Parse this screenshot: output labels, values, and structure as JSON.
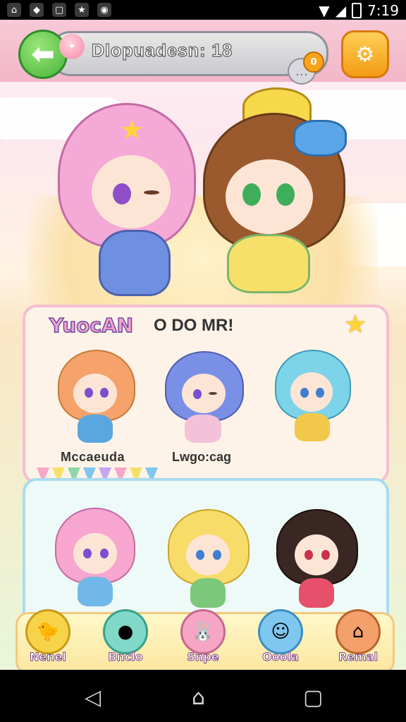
{
  "status_bar": {
    "time": "7:19",
    "apps": [
      {
        "icon": "app-icon-1",
        "glyph": "⌂"
      },
      {
        "icon": "app-icon-2",
        "glyph": "◆"
      },
      {
        "icon": "app-icon-3",
        "glyph": "▢"
      },
      {
        "icon": "app-icon-4",
        "glyph": "★"
      },
      {
        "icon": "app-icon-5",
        "glyph": "◉"
      }
    ]
  },
  "header": {
    "title": "Dlopuadesn: 18",
    "badge_count": "0",
    "back_glyph": "⬅",
    "settings_glyph": "⚙"
  },
  "panel1": {
    "title": "YuocAN",
    "subtitle": "O DO MR!",
    "characters": [
      {
        "label": "Mccaeuda",
        "hair": "#f5a36a",
        "outfit": "#5aa6e0"
      },
      {
        "label": "Lwgo:cag",
        "hair": "#7a8fe6",
        "outfit": "#f3c2d8"
      },
      {
        "label": "",
        "hair": "#7dd3e8",
        "outfit": "#f2c84b"
      }
    ]
  },
  "panel2": {
    "characters": [
      {
        "hair": "#f6a6cf",
        "outfit": "#6fb8e8"
      },
      {
        "hair": "#f7dc6a",
        "outfit": "#7cc77a"
      },
      {
        "hair": "#3a2622",
        "outfit": "#e6506a"
      }
    ]
  },
  "hero": {
    "left_hair": "#f4a9d6",
    "right_hair": "#9b5a2e"
  },
  "bottom_nav": [
    {
      "label": "Nenel",
      "icon": "chick-icon",
      "color": "#f7d34a"
    },
    {
      "label": "Bnclo",
      "icon": "blob-icon",
      "color": "#7fd8c8"
    },
    {
      "label": "Snpe",
      "icon": "bunny-icon",
      "color": "#f6a6c4"
    },
    {
      "label": "Ooola",
      "icon": "ghost-icon",
      "color": "#7fc7ef"
    },
    {
      "label": "Remal",
      "icon": "house-icon",
      "color": "#f3a06a"
    }
  ],
  "colors": {
    "accent_pink": "#f5bfd0",
    "accent_blue": "#a9dbef",
    "accent_yellow": "#f7d34a"
  }
}
